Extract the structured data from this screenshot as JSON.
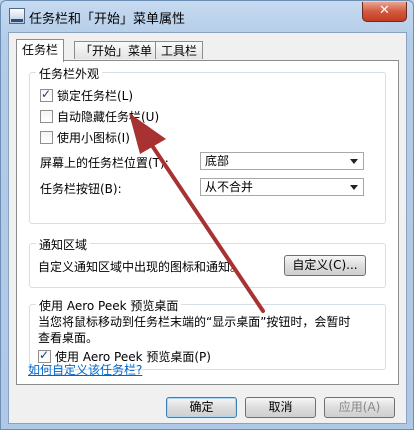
{
  "window": {
    "title": "任务栏和「开始」菜单属性",
    "close_symbol": "✕",
    "icon": "taskbar-app-icon"
  },
  "tabs": [
    {
      "label": "任务栏",
      "active": true
    },
    {
      "label": "「开始」菜单",
      "active": false
    },
    {
      "label": "工具栏",
      "active": false
    }
  ],
  "appearance": {
    "legend": "任务栏外观",
    "lock_taskbar": {
      "label": "锁定任务栏(L)",
      "checked": true
    },
    "auto_hide": {
      "label": "自动隐藏任务栏(U)",
      "checked": false
    },
    "small_icons": {
      "label": "使用小图标(I)",
      "checked": false
    },
    "location_label": "屏幕上的任务栏位置(T):",
    "location_value": "底部",
    "buttons_label": "任务栏按钮(B):",
    "buttons_value": "从不合并"
  },
  "notification": {
    "legend": "通知区域",
    "description": "自定义通知区域中出现的图标和通知。",
    "customize_button": "自定义(C)..."
  },
  "aero_peek": {
    "legend": "使用 Aero Peek 预览桌面",
    "description_line1": "当您将鼠标移动到任务栏末端的“显示桌面”按钮时，会暂时",
    "description_line2": "查看桌面。",
    "checkbox": {
      "label": "使用 Aero Peek 预览桌面(P)",
      "checked": true
    }
  },
  "help_link": "如何自定义该任务栏?",
  "footer": {
    "ok": "确定",
    "cancel": "取消",
    "apply": "应用(A)"
  },
  "annotation": {
    "color": "#a83232"
  }
}
